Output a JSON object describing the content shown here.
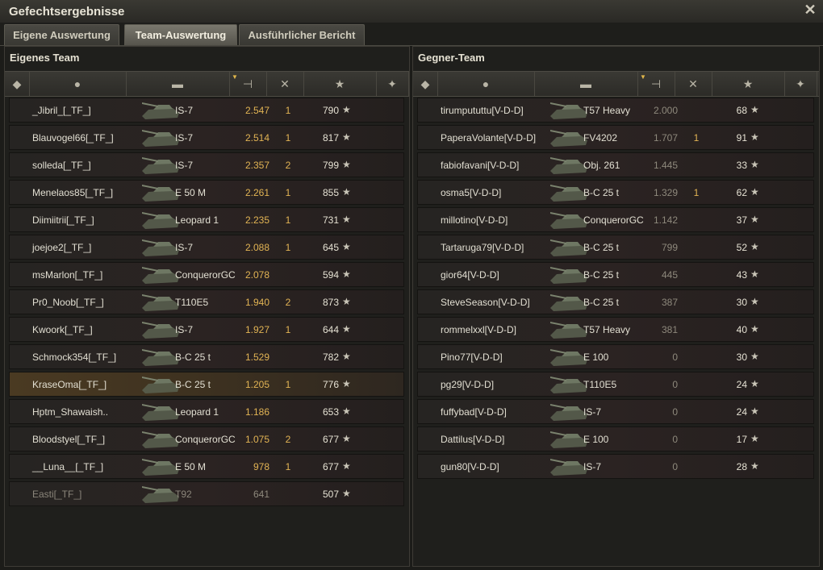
{
  "window": {
    "title": "Gefechtsergebnisse"
  },
  "tabs": [
    {
      "label": "Eigene Auswertung"
    },
    {
      "label": "Team-Auswertung"
    },
    {
      "label": "Ausführlicher Bericht"
    }
  ],
  "own_team": {
    "title": "Eigenes Team",
    "rows": [
      {
        "name": "_Jibril_[_TF_]",
        "tank": "IS-7",
        "damage": "2.547",
        "frags": "1",
        "xp": "790"
      },
      {
        "name": "Blauvogel66[_TF_]",
        "tank": "IS-7",
        "damage": "2.514",
        "frags": "1",
        "xp": "817"
      },
      {
        "name": "solleda[_TF_]",
        "tank": "IS-7",
        "damage": "2.357",
        "frags": "2",
        "xp": "799"
      },
      {
        "name": "Menelaos85[_TF_]",
        "tank": "E 50 M",
        "damage": "2.261",
        "frags": "1",
        "xp": "855"
      },
      {
        "name": "Diimiitrii[_TF_]",
        "tank": "Leopard 1",
        "damage": "2.235",
        "frags": "1",
        "xp": "731"
      },
      {
        "name": "joejoe2[_TF_]",
        "tank": "IS-7",
        "damage": "2.088",
        "frags": "1",
        "xp": "645"
      },
      {
        "name": "msMarlon[_TF_]",
        "tank": "ConquerorGC",
        "damage": "2.078",
        "frags": "",
        "xp": "594"
      },
      {
        "name": "Pr0_Noob[_TF_]",
        "tank": "T110E5",
        "damage": "1.940",
        "frags": "2",
        "xp": "873"
      },
      {
        "name": "Kwoork[_TF_]",
        "tank": "IS-7",
        "damage": "1.927",
        "frags": "1",
        "xp": "644"
      },
      {
        "name": "Schmock354[_TF_]",
        "tank": "B-C 25 t",
        "damage": "1.529",
        "frags": "",
        "xp": "782"
      },
      {
        "name": "KraseOma[_TF_]",
        "tank": "B-C 25 t",
        "damage": "1.205",
        "frags": "1",
        "xp": "776"
      },
      {
        "name": "Hptm_Shawaish..",
        "tank": "Leopard 1",
        "damage": "1.186",
        "frags": "",
        "xp": "653"
      },
      {
        "name": "Bloodstyel[_TF_]",
        "tank": "ConquerorGC",
        "damage": "1.075",
        "frags": "2",
        "xp": "677"
      },
      {
        "name": "__Luna__[_TF_]",
        "tank": "E 50 M",
        "damage": "978",
        "frags": "1",
        "xp": "677"
      },
      {
        "name": "Easti[_TF_]",
        "tank": "T92",
        "damage": "641",
        "frags": "",
        "xp": "507"
      }
    ]
  },
  "enemy_team": {
    "title": "Gegner-Team",
    "rows": [
      {
        "name": "tirumpututtu[V-D-D]",
        "tank": "T57 Heavy",
        "damage": "2.000",
        "frags": "",
        "xp": "68"
      },
      {
        "name": "PaperaVolante[V-D-D]",
        "tank": "FV4202",
        "damage": "1.707",
        "frags": "1",
        "xp": "91"
      },
      {
        "name": "fabiofavani[V-D-D]",
        "tank": "Obj. 261",
        "damage": "1.445",
        "frags": "",
        "xp": "33"
      },
      {
        "name": "osma5[V-D-D]",
        "tank": "B-C 25 t",
        "damage": "1.329",
        "frags": "1",
        "xp": "62"
      },
      {
        "name": "millotino[V-D-D]",
        "tank": "ConquerorGC",
        "damage": "1.142",
        "frags": "",
        "xp": "37"
      },
      {
        "name": "Tartaruga79[V-D-D]",
        "tank": "B-C 25 t",
        "damage": "799",
        "frags": "",
        "xp": "52"
      },
      {
        "name": "gior64[V-D-D]",
        "tank": "B-C 25 t",
        "damage": "445",
        "frags": "",
        "xp": "43"
      },
      {
        "name": "SteveSeason[V-D-D]",
        "tank": "B-C 25 t",
        "damage": "387",
        "frags": "",
        "xp": "30"
      },
      {
        "name": "rommelxxl[V-D-D]",
        "tank": "T57 Heavy",
        "damage": "381",
        "frags": "",
        "xp": "40"
      },
      {
        "name": "Pino77[V-D-D]",
        "tank": "E 100",
        "damage": "0",
        "frags": "",
        "xp": "30"
      },
      {
        "name": "pg29[V-D-D]",
        "tank": "T110E5",
        "damage": "0",
        "frags": "",
        "xp": "24"
      },
      {
        "name": "fuffybad[V-D-D]",
        "tank": "IS-7",
        "damage": "0",
        "frags": "",
        "xp": "24"
      },
      {
        "name": "Dattilus[V-D-D]",
        "tank": "E 100",
        "damage": "0",
        "frags": "",
        "xp": "17"
      },
      {
        "name": "gun80[V-D-D]",
        "tank": "IS-7",
        "damage": "0",
        "frags": "",
        "xp": "28"
      }
    ]
  },
  "columns": [
    {
      "icon": "squad-icon"
    },
    {
      "icon": "player-icon"
    },
    {
      "icon": "tank-icon"
    },
    {
      "icon": "damage-icon",
      "sorted": true
    },
    {
      "icon": "frags-icon"
    },
    {
      "icon": "xp-star-icon"
    },
    {
      "icon": "medal-icon"
    }
  ],
  "colors": {
    "highlight_gold": "#e2b454",
    "player_row": "#4a3a22",
    "background": "#1c1c19"
  }
}
